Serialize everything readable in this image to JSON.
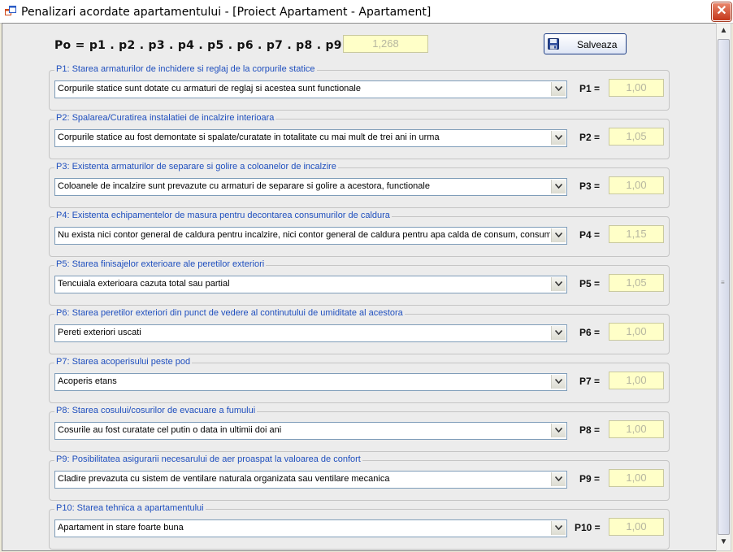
{
  "window": {
    "title": "Penalizari acordate apartamentului - [Proiect Apartament - Apartament]",
    "close_symbol": "✕"
  },
  "formula": {
    "text": "Po  =  p1 .  p2 .  p3 . p4 . p5 . p6 . p7 . p8 . p9 . p10   =",
    "po_value": "1,268"
  },
  "toolbar": {
    "save_label": "Salveaza"
  },
  "icons": {
    "app": "app-window-icon",
    "save": "floppy-disk-icon",
    "dropdown": "chevron-down-icon"
  },
  "penalties": [
    {
      "title": "P1: Starea armaturilor de inchidere si reglaj de la corpurile statice",
      "selected": "Corpurile statice sunt dotate cu armaturi de reglaj si acestea sunt functionale",
      "label": "P1 =",
      "value": "1,00"
    },
    {
      "title": "P2: Spalarea/Curatirea instalatiei de incalzire interioara",
      "selected": "Corpurile statice au fost demontate si spalate/curatate in totalitate cu mai mult de trei ani in urma",
      "label": "P2 =",
      "value": "1,05"
    },
    {
      "title": "P3: Existenta armaturilor de separare si golire a coloanelor de incalzire",
      "selected": "Coloanele de incalzire sunt prevazute cu armaturi de separare si golire a acestora, functionale",
      "label": "P3 =",
      "value": "1,00"
    },
    {
      "title": "P4: Existenta echipamentelor de masura pentru decontarea consumurilor de caldura",
      "selected": "Nu exista nici contor general de caldura pentru incalzire, nici contor general de caldura pentru apa calda de consum, consumuril",
      "label": "P4 =",
      "value": "1,15"
    },
    {
      "title": "P5: Starea finisajelor exterioare ale peretilor exteriori",
      "selected": "Tencuiala exterioara cazuta total sau partial",
      "label": "P5 =",
      "value": "1,05"
    },
    {
      "title": "P6: Starea peretilor exteriori din punct de vedere al continutului de umiditate al acestora",
      "selected": "Pereti exteriori uscati",
      "label": "P6 =",
      "value": "1,00"
    },
    {
      "title": "P7: Starea acoperisului peste pod",
      "selected": "Acoperis etans",
      "label": "P7 =",
      "value": "1,00"
    },
    {
      "title": "P8: Starea cosului/cosurilor de evacuare a fumului",
      "selected": "Cosurile au fost curatate cel putin o data in ultimii doi ani",
      "label": "P8 =",
      "value": "1,00"
    },
    {
      "title": "P9: Posibilitatea asigurarii necesarului de aer proaspat la valoarea de confort",
      "selected": "Cladire prevazuta cu sistem de ventilare naturala organizata sau ventilare mecanica",
      "label": "P9 =",
      "value": "1,00"
    },
    {
      "title": "P10: Starea tehnica a apartamentului",
      "selected": "Apartament in stare foarte buna",
      "label": "P10 =",
      "value": "1,00"
    }
  ],
  "scrollbar": {
    "up_symbol": "▲",
    "down_symbol": "▼",
    "grip": "≡"
  }
}
